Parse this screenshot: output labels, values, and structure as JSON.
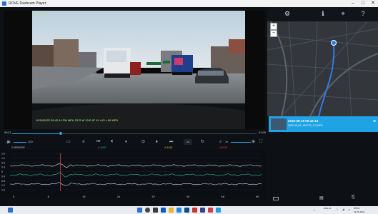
{
  "window": {
    "title": "ROVE Dashcam Player",
    "minimize_glyph": "–",
    "maximize_glyph": "□",
    "close_glyph": "✕"
  },
  "video": {
    "corner_label": "ROVE R3",
    "overlay_stamp": "10/10/2022 05:42:14 PM    MPH 23 R W  10 E:97 10 ±13 ± 60 MPH"
  },
  "map": {
    "zoom_in": "+",
    "zoom_out": "−",
    "top_icons": [
      "gear-icon",
      "info-icon",
      "map-pin-icon",
      "help-icon"
    ],
    "top_glyphs": [
      "⚙",
      "ℹ",
      "⌖",
      "?"
    ]
  },
  "info_card": {
    "line1": "2022-06-19 05:42:14",
    "line2": "2022-06-19 / 66°F22 / 0.3 MPH",
    "menu_glyph": "≡"
  },
  "playback": {
    "time_current": "00:11",
    "time_total": "01:00",
    "progress": 0.2
  },
  "controls": {
    "volume_value": "100",
    "labels": {
      "gsensor": "G-SENSOR",
      "accel": "X-AXIS",
      "gyro": "Z-AXIS",
      "speed": "Y-AXIS"
    },
    "label_colors": {
      "gsensor": "#d0d8e0",
      "accel": "#2fa3e0",
      "gyro": "#e4c233",
      "speed": "#e04a4a"
    },
    "zoom_value": "1x",
    "zoom_right": "1x"
  },
  "graph": {
    "y_labels": [
      "1.6",
      "1.2",
      "0.8",
      "0.4",
      "0",
      "0.4",
      "0.8",
      "1.2",
      "1.6"
    ],
    "x_labels": [
      "0",
      "8",
      "16",
      "24",
      "32",
      "40",
      "48",
      "56"
    ],
    "cursor_position": 0.2
  },
  "taskbar": {
    "clock_time": "00:11",
    "clock_date": "19-06-2022",
    "lang": "ENG IN"
  }
}
